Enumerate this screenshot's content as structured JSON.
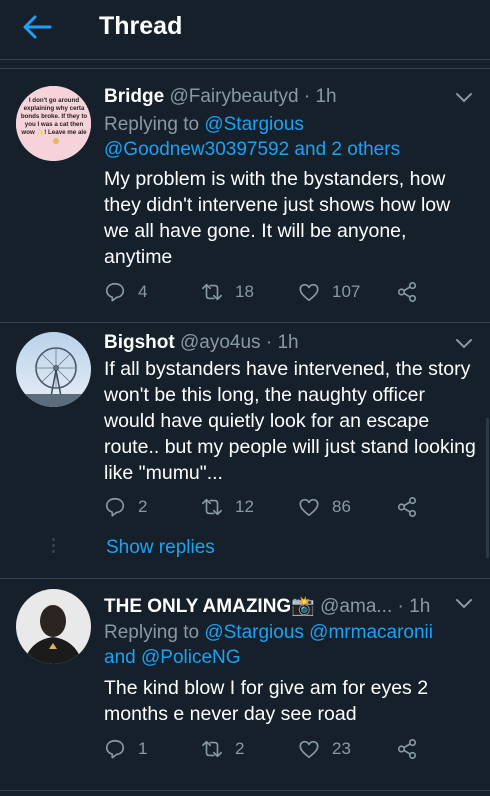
{
  "header": {
    "title": "Thread",
    "back_icon": "arrow-left-icon"
  },
  "tweets": [
    {
      "name": "Bridge",
      "handle": "@Fairybeautyd",
      "time": "· 1h",
      "reply_prefix": "Replying to",
      "reply_line1": "@Stargious",
      "reply_line2": "@Goodnew30397592 and 2 others",
      "text": "My problem is with the bystanders, how they didn't intervene just shows how low we all have gone. It will be anyone, anytime",
      "replies": "4",
      "retweets": "18",
      "likes": "107",
      "avatar_text": [
        "I don't go around",
        "explaining why certa",
        "bonds broke. If they to",
        "you I was a cat then",
        "wow ✨! Leave me ale"
      ]
    },
    {
      "name": "Bigshot",
      "handle": "@ayo4us",
      "time": "· 1h",
      "text": "If all bystanders have intervened, the story won't be this long, the naughty officer would have quietly look for an escape route.. but my people will just stand looking like \"mumu\"...",
      "replies": "2",
      "retweets": "12",
      "likes": "86",
      "show_replies": "Show replies"
    },
    {
      "name": "THE ONLY AMAZING📸",
      "handle": "@ama...",
      "time": "· 1h",
      "reply_prefix": "Replying to",
      "reply_mentions": "@Stargious @mrmacaronii",
      "reply_and": "and",
      "reply_last": "@PoliceNG",
      "text": "The kind blow I for give am for eyes 2 months e never day see road",
      "replies": "1",
      "retweets": "2",
      "likes": "23"
    }
  ],
  "colors": {
    "background": "#15202b",
    "accent": "#1da1f2",
    "muted": "#8899a6",
    "divider": "#38444d"
  },
  "icons": [
    "reply-icon",
    "retweet-icon",
    "like-icon",
    "share-icon",
    "chevron-down-icon"
  ]
}
